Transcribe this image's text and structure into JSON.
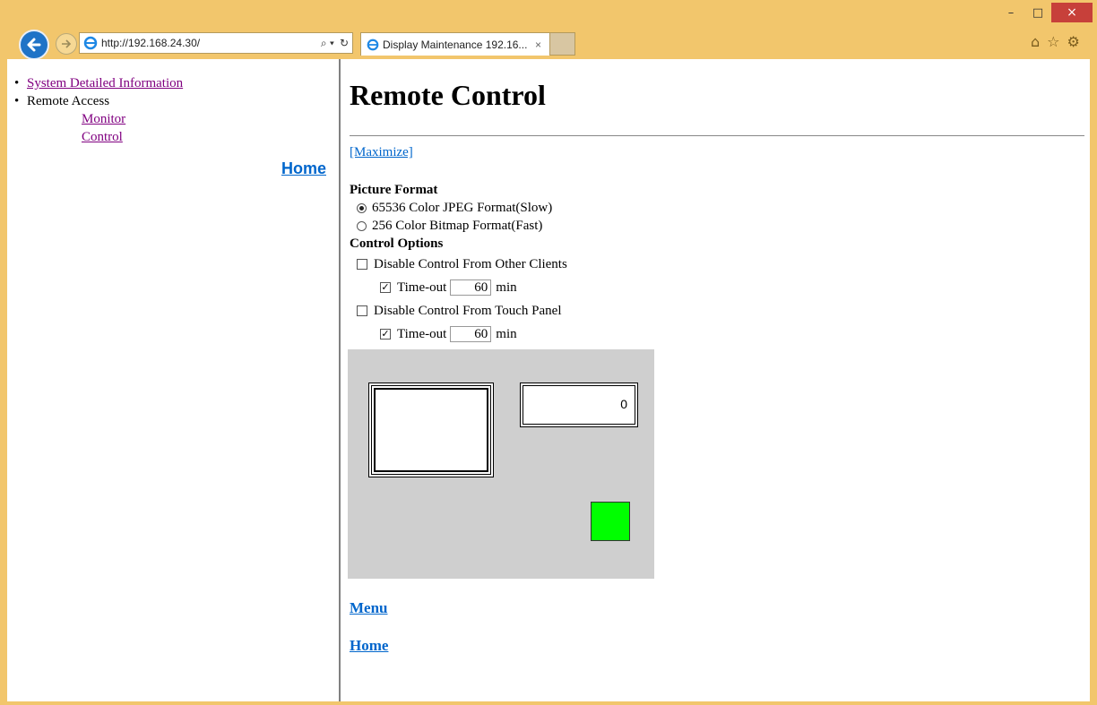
{
  "browser": {
    "address_url": "http://192.168.24.30/",
    "tab_title": "Display Maintenance 192.16...",
    "tab_close": "×",
    "window_min": "–",
    "window_max": "□",
    "window_close": "×",
    "search_glyph": "⌕ ▾",
    "refresh_glyph": "↻"
  },
  "nav": {
    "items": [
      {
        "label": "System Detailed Information"
      },
      {
        "label": "Remote Access"
      }
    ],
    "sub_items": [
      {
        "label": "Monitor"
      },
      {
        "label": "Control"
      }
    ],
    "home": "Home"
  },
  "main": {
    "title": "Remote Control",
    "maximize": "[Maximize]",
    "picture_format_header": "Picture Format",
    "format_options": [
      {
        "label": "65536 Color JPEG Format(Slow)",
        "selected": true
      },
      {
        "label": "256 Color Bitmap Format(Fast)",
        "selected": false
      }
    ],
    "control_options_header": "Control Options",
    "disable_other_clients": {
      "label": "Disable Control From Other Clients",
      "checked": false
    },
    "timeout1": {
      "label": "Time-out",
      "checked": true,
      "value": "60",
      "unit": "min"
    },
    "disable_touch_panel": {
      "label": "Disable Control From Touch Panel",
      "checked": false
    },
    "timeout2": {
      "label": "Time-out",
      "checked": true,
      "value": "60",
      "unit": "min"
    },
    "panel": {
      "counter_value": "0",
      "button_color": "#00ff00"
    },
    "menu_link": "Menu",
    "home_link": "Home"
  }
}
